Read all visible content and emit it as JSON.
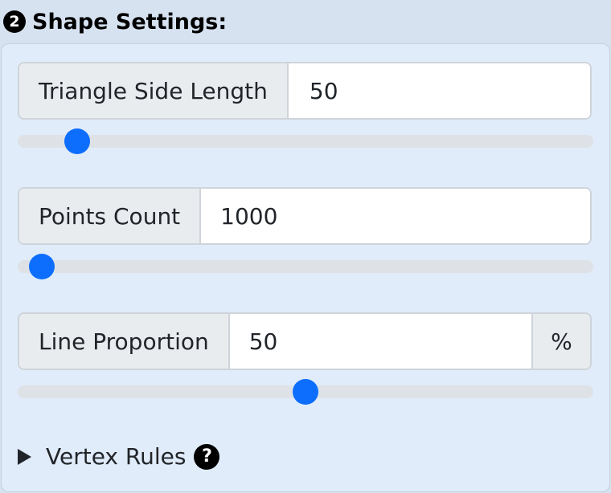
{
  "header": {
    "step_number": "2",
    "title": "Shape Settings:"
  },
  "fields": [
    {
      "label": "Triangle Side Length",
      "value": "50",
      "suffix": null,
      "slider_fraction": 0.08
    },
    {
      "label": "Points Count",
      "value": "1000",
      "suffix": null,
      "slider_fraction": 0.015
    },
    {
      "label": "Line Proportion",
      "value": "50",
      "suffix": "%",
      "slider_fraction": 0.5
    }
  ],
  "details": {
    "label": "Vertex Rules",
    "help_icon": "?"
  },
  "colors": {
    "accent": "#0d6efd",
    "panel_bg": "#e1ecfa",
    "page_bg": "#d6e2f0"
  }
}
